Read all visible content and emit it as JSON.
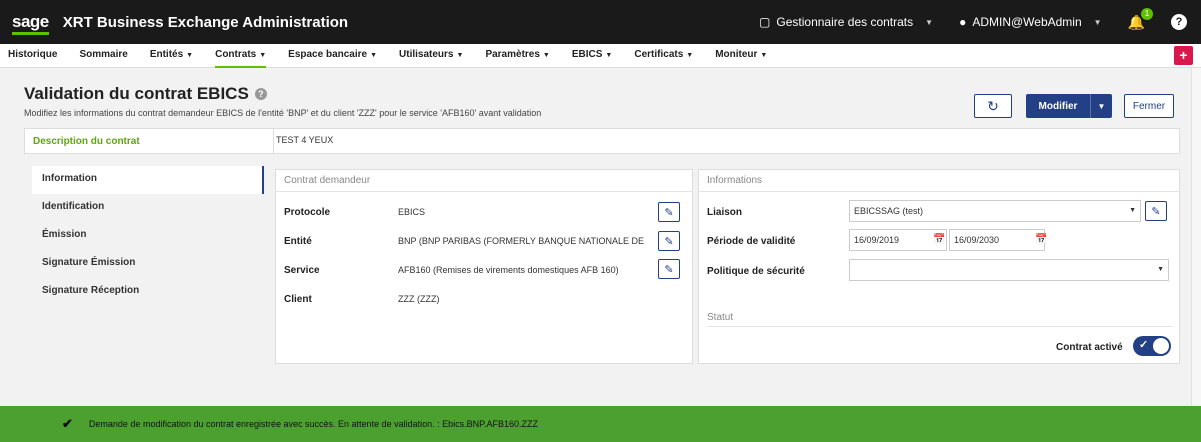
{
  "header": {
    "logo": "sage",
    "app_title": "XRT Business Exchange Administration",
    "role_label": "Gestionnaire des contrats",
    "user_label": "ADMIN@WebAdmin",
    "notification_count": "1",
    "help_label": "?"
  },
  "nav": {
    "items": [
      {
        "label": "Historique"
      },
      {
        "label": "Sommaire"
      },
      {
        "label": "Entités"
      },
      {
        "label": "Contrats"
      },
      {
        "label": "Espace bancaire"
      },
      {
        "label": "Utilisateurs"
      },
      {
        "label": "Paramètres"
      },
      {
        "label": "EBICS"
      },
      {
        "label": "Certificats"
      },
      {
        "label": "Moniteur"
      }
    ],
    "active": "Contrats",
    "plus_label": "+"
  },
  "page": {
    "title": "Validation du contrat EBICS",
    "subtitle": "Modifiez les informations du contrat demandeur EBICS de l'entité 'BNP' et du client 'ZZZ' pour le service 'AFB160' avant validation",
    "modify_label": "Modifier",
    "close_label": "Fermer",
    "description_label": "Description du contrat",
    "description_value": "TEST 4 YEUX"
  },
  "side_tabs": [
    {
      "label": "Information"
    },
    {
      "label": "Identification"
    },
    {
      "label": "Émission"
    },
    {
      "label": "Signature Émission"
    },
    {
      "label": "Signature Réception"
    }
  ],
  "contrat_demandeur": {
    "title": "Contrat demandeur",
    "protocole_label": "Protocole",
    "protocole_value": "EBICS",
    "entite_label": "Entité",
    "entite_value": "BNP (BNP PARIBAS (FORMERLY BANQUE NATIONALE DE",
    "service_label": "Service",
    "service_value": "AFB160 (Remises de virements domestiques AFB 160)",
    "client_label": "Client",
    "client_value": "ZZZ (ZZZ)"
  },
  "informations": {
    "title": "Informations",
    "liaison_label": "Liaison",
    "liaison_value": "EBICSSAG (test)",
    "periode_label": "Période de validité",
    "date_start": "16/09/2019",
    "date_end": "16/09/2030",
    "politique_label": "Politique de sécurité",
    "politique_value": "",
    "statut_title": "Statut",
    "contrat_active_label": "Contrat activé",
    "contrat_active": true
  },
  "banner": {
    "message": "Demande de modification du contrat enregistrée avec succès. En attente de validation. : Ebics.BNP.AFB160.ZZZ",
    "color": "#4ca02f"
  },
  "colors": {
    "accent_green": "#5fbf00",
    "primary_blue": "#233f86",
    "plus_red": "#d9194d"
  }
}
